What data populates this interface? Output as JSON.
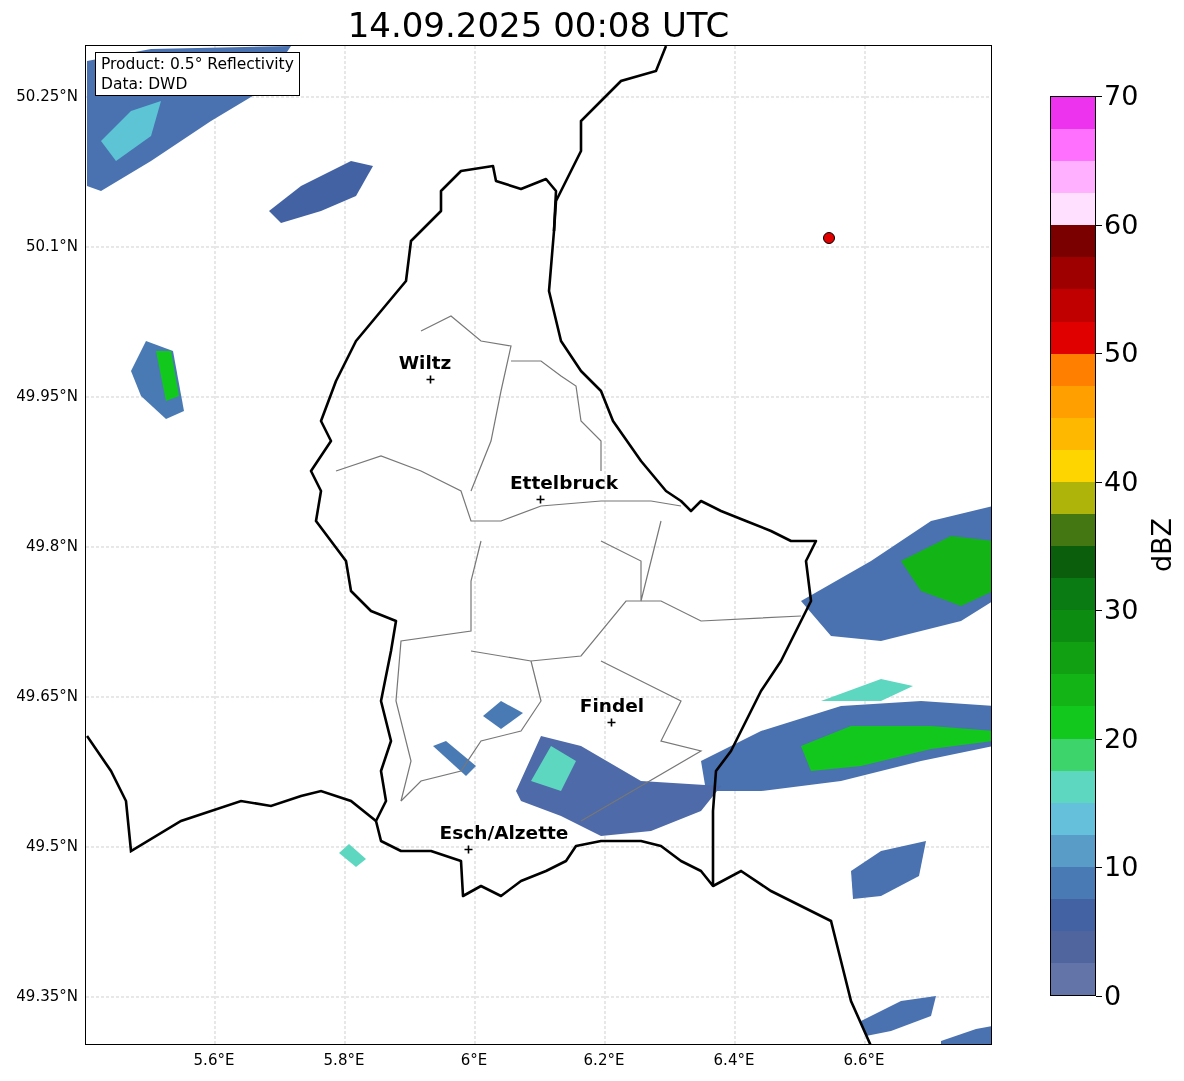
{
  "title": "14.09.2025 00:08 UTC",
  "info_box": {
    "lines": [
      "Product: 0.5° Reflectivity",
      "Data: DWD"
    ]
  },
  "map": {
    "cities": [
      {
        "name": "Wiltz"
      },
      {
        "name": "Ettelbruck"
      },
      {
        "name": "Findel"
      },
      {
        "name": "Esch/Alzette"
      }
    ],
    "y_ticks": [
      "50.25°N",
      "50.1°N",
      "49.95°N",
      "49.8°N",
      "49.65°N",
      "49.5°N",
      "49.35°N"
    ],
    "x_ticks": [
      "5.6°E",
      "5.8°E",
      "6°E",
      "6.2°E",
      "6.4°E",
      "6.6°E"
    ]
  },
  "colorbar": {
    "label": "dBZ",
    "ticks": [
      "70",
      "60",
      "50",
      "40",
      "30",
      "20",
      "10",
      "0"
    ],
    "bands": [
      {
        "color": "#ee33ee"
      },
      {
        "color": "#ff70ff"
      },
      {
        "color": "#ffb0ff"
      },
      {
        "color": "#ffe0ff"
      },
      {
        "color": "#7a0000"
      },
      {
        "color": "#9e0000"
      },
      {
        "color": "#c00000"
      },
      {
        "color": "#e00000"
      },
      {
        "color": "#ff7f00"
      },
      {
        "color": "#ff9f00"
      },
      {
        "color": "#ffb800"
      },
      {
        "color": "#ffd500"
      },
      {
        "color": "#afb40a"
      },
      {
        "color": "#447712"
      },
      {
        "color": "#0b5e0b"
      },
      {
        "color": "#0a7a12"
      },
      {
        "color": "#0d8c12"
      },
      {
        "color": "#10a012"
      },
      {
        "color": "#12b416"
      },
      {
        "color": "#12c81c"
      },
      {
        "color": "#3dd46b"
      },
      {
        "color": "#5dd7c0"
      },
      {
        "color": "#64c0db"
      },
      {
        "color": "#5a9cc8"
      },
      {
        "color": "#4a7ab4"
      },
      {
        "color": "#4262a4"
      },
      {
        "color": "#50659e"
      },
      {
        "color": "#6274a8"
      }
    ]
  }
}
